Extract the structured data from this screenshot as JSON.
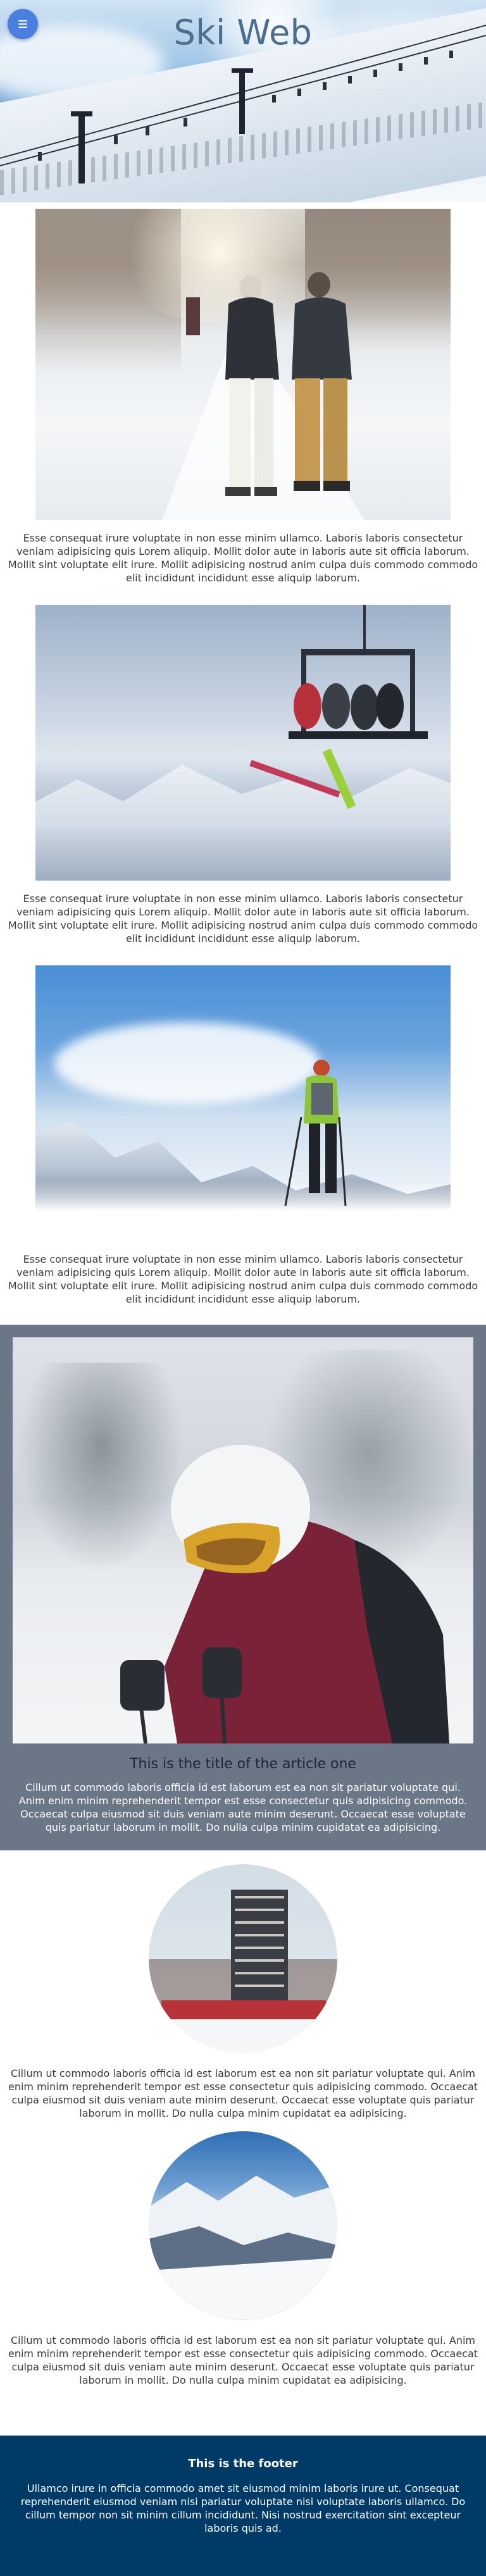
{
  "header": {
    "title": "Ski Web",
    "menu_icon": "hamburger-menu-icon"
  },
  "sections": [
    {
      "image": "two-people-walking-on-snowy-path",
      "text": "Esse consequat irure voluptate in non esse minim ullamco. Laboris laboris consectetur veniam adipisicing quis Lorem aliquip. Mollit dolor aute in laboris aute sit officia laborum. Mollit sint voluptate elit irure. Mollit adipisicing nostrud anim culpa duis commodo commodo elit incididunt incididunt esse aliquip laborum."
    },
    {
      "image": "skiers-on-chairlift",
      "text": "Esse consequat irure voluptate in non esse minim ullamco. Laboris laboris consectetur veniam adipisicing quis Lorem aliquip. Mollit dolor aute in laboris aute sit officia laborum. Mollit sint voluptate elit irure. Mollit adipisicing nostrud anim culpa duis commodo commodo elit incididunt incididunt esse aliquip laborum."
    },
    {
      "image": "skier-on-mountain-peak",
      "text": "Esse consequat irure voluptate in non esse minim ullamco. Laboris laboris consectetur veniam adipisicing quis Lorem aliquip. Mollit dolor aute in laboris aute sit officia laborum. Mollit sint voluptate elit irure. Mollit adipisicing nostrud anim culpa duis commodo commodo elit incididunt incididunt esse aliquip laborum."
    }
  ],
  "article": {
    "image": "skier-with-goggles-and-helmet",
    "title": "This is the title of the article one",
    "text": "Cillum ut commodo laboris officia id est laborum est ea non sit pariatur voluptate qui. Anim enim minim reprehenderit tempor est esse consectetur quis adipisicing commodo. Occaecat culpa eiusmod sit duis veniam aute minim deserunt. Occaecat esse voluptate quis pariatur laborum in mollit. Do nulla culpa minim cupidatat ea adipisicing."
  },
  "round_items": [
    {
      "image": "ski-resort-tower-building",
      "text": "Cillum ut commodo laboris officia id est laborum est ea non sit pariatur voluptate qui. Anim enim minim reprehenderit tempor est esse consectetur quis adipisicing commodo. Occaecat culpa eiusmod sit duis veniam aute minim deserunt. Occaecat esse voluptate quis pariatur laborum in mollit. Do nulla culpa minim cupidatat ea adipisicing."
    },
    {
      "image": "snowy-mountain-valley",
      "text": "Cillum ut commodo laboris officia id est laborum est ea non sit pariatur voluptate qui. Anim enim minim reprehenderit tempor est esse consectetur quis adipisicing commodo. Occaecat culpa eiusmod sit duis veniam aute minim deserunt. Occaecat esse voluptate quis pariatur laborum in mollit. Do nulla culpa minim cupidatat ea adipisicing."
    }
  ],
  "footer": {
    "title": "This is the footer",
    "text": "Ullamco irure in officia commodo amet sit eiusmod minim laboris irure ut. Consequat reprehenderit eiusmod veniam nisi pariatur voluptate nisi voluptate laboris ullamco. Do cillum tempor non sit minim cillum incididunt. Nisi nostrud exercitation sint excepteur laboris quis ad."
  },
  "colors": {
    "menu_button": "#4a7fe0",
    "title": "#4d6d8d",
    "article_bg": "#6b7687",
    "footer_bg": "#003a66"
  }
}
